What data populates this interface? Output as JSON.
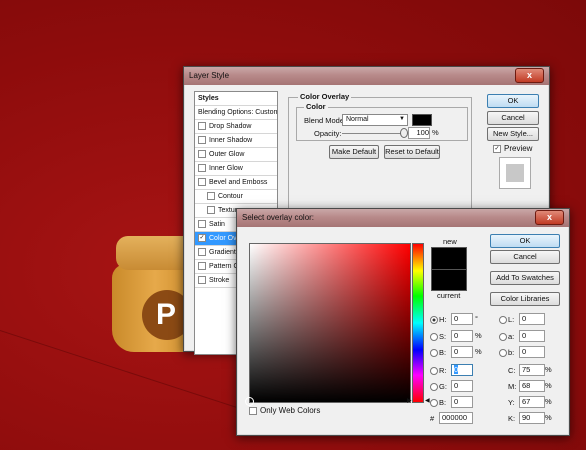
{
  "layer_style": {
    "title": "Layer Style",
    "close": "x",
    "styles_header": "Styles",
    "items": [
      {
        "label": "Blending Options: Custom",
        "check": false,
        "sub": false,
        "selected": false,
        "has_check": false
      },
      {
        "label": "Drop Shadow",
        "check": false,
        "sub": false,
        "selected": false,
        "has_check": true
      },
      {
        "label": "Inner Shadow",
        "check": false,
        "sub": false,
        "selected": false,
        "has_check": true
      },
      {
        "label": "Outer Glow",
        "check": false,
        "sub": false,
        "selected": false,
        "has_check": true
      },
      {
        "label": "Inner Glow",
        "check": false,
        "sub": false,
        "selected": false,
        "has_check": true
      },
      {
        "label": "Bevel and Emboss",
        "check": false,
        "sub": false,
        "selected": false,
        "has_check": true
      },
      {
        "label": "Contour",
        "check": false,
        "sub": true,
        "selected": false,
        "has_check": true
      },
      {
        "label": "Texture",
        "check": false,
        "sub": true,
        "selected": false,
        "has_check": true
      },
      {
        "label": "Satin",
        "check": false,
        "sub": false,
        "selected": false,
        "has_check": true
      },
      {
        "label": "Color Overlay",
        "check": true,
        "sub": false,
        "selected": true,
        "has_check": true
      },
      {
        "label": "Gradient Overlay",
        "check": false,
        "sub": false,
        "selected": false,
        "has_check": true
      },
      {
        "label": "Pattern Overlay",
        "check": false,
        "sub": false,
        "selected": false,
        "has_check": true
      },
      {
        "label": "Stroke",
        "check": false,
        "sub": false,
        "selected": false,
        "has_check": true
      }
    ],
    "panel_title": "Color Overlay",
    "color_group": "Color",
    "blend_mode_label": "Blend Mode:",
    "blend_mode_value": "Normal",
    "opacity_label": "Opacity:",
    "opacity_value": "100",
    "opacity_unit": "%",
    "make_default": "Make Default",
    "reset_default": "Reset to Default",
    "ok": "OK",
    "cancel": "Cancel",
    "new_style": "New Style...",
    "preview": "Preview"
  },
  "picker": {
    "title": "Select overlay color:",
    "close": "x",
    "new_label": "new",
    "current_label": "current",
    "ok": "OK",
    "cancel": "Cancel",
    "add_swatches": "Add To Swatches",
    "color_libraries": "Color Libraries",
    "only_web": "Only Web Colors",
    "hsb": [
      {
        "label": "H:",
        "value": "0",
        "unit": "°"
      },
      {
        "label": "S:",
        "value": "0",
        "unit": "%"
      },
      {
        "label": "B:",
        "value": "0",
        "unit": "%"
      }
    ],
    "rgb": [
      {
        "label": "R:",
        "value": "0"
      },
      {
        "label": "G:",
        "value": "0"
      },
      {
        "label": "B:",
        "value": "0"
      }
    ],
    "lab": [
      {
        "label": "L:",
        "value": "0"
      },
      {
        "label": "a:",
        "value": "0"
      },
      {
        "label": "b:",
        "value": "0"
      }
    ],
    "cmyk": [
      {
        "label": "C:",
        "value": "75",
        "unit": "%"
      },
      {
        "label": "M:",
        "value": "68",
        "unit": "%"
      },
      {
        "label": "Y:",
        "value": "67",
        "unit": "%"
      },
      {
        "label": "K:",
        "value": "90",
        "unit": "%"
      }
    ],
    "hex_label": "#",
    "hex_value": "000000"
  },
  "canvas": {
    "jar_letter": "P"
  },
  "colors": {
    "background": "#9a0f0f",
    "overlay_color": "#000000",
    "selection": "#3399ff"
  }
}
